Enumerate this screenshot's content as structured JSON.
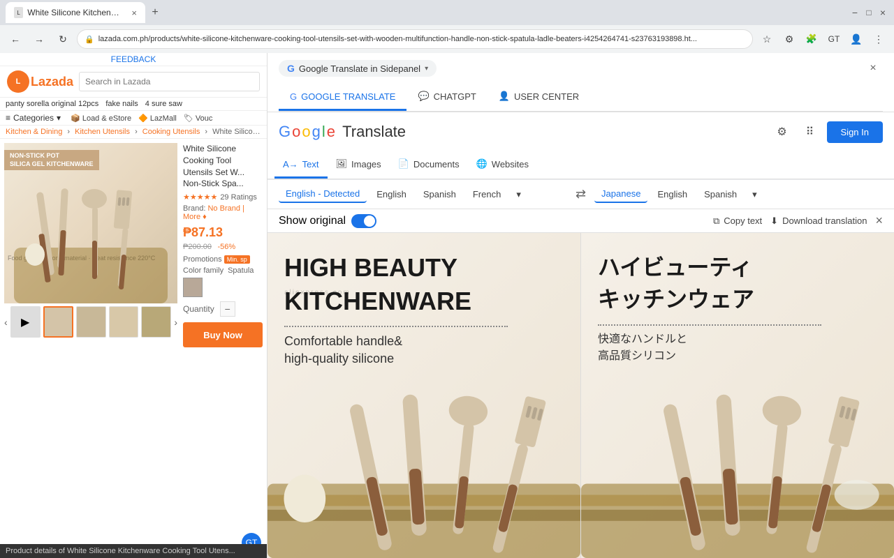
{
  "browser": {
    "tab_title": "White Silicone Kitchenware C...",
    "url": "lazada.com.ph/products/white-silicone-kitchenware-cooking-tool-utensils-set-with-wooden-multifunction-handle-non-stick-spatula-ladle-beaters-i4254264741-s23763193898.ht...",
    "new_tab_label": "+",
    "back_icon": "←",
    "forward_icon": "→",
    "reload_icon": "↻",
    "home_icon": "⌂",
    "extensions_icon": "⚙",
    "window_controls": {
      "minimize": "−",
      "maximize": "□",
      "close": "×"
    }
  },
  "lazada": {
    "feedback_label": "FEEDBACK",
    "logo_text": "Lazada",
    "search_placeholder": "Search in Lazada",
    "nav_items": [
      "Load & eStore",
      "LazMall",
      "Vouc"
    ],
    "nav_scrolling_items": [
      "panty sorella original 12pcs",
      "fake nails",
      "4 sure saw"
    ],
    "categories_label": "Categories",
    "breadcrumbs": [
      "Kitchen & Dining",
      "Kitchen Utensils",
      "Cooking Utensils",
      "White Silicone Kitc..."
    ],
    "product_title": "White Silicone Cooking Tool Utensils Set W... Non-Stick Spa...",
    "rating": "★★★★★",
    "rating_count": "29 Ratings",
    "brand_label": "Brand:",
    "brand_value": "No Brand",
    "brand_more": "More ♦",
    "price_current": "₱87.13",
    "price_original": "₱200.00",
    "price_discount": "-56%",
    "promotions_label": "Promotions",
    "promo_badge": "Min. sp",
    "color_family_label": "Color family",
    "color_name": "Spatula",
    "quantity_label": "Quantity",
    "qty_minus": "−",
    "buy_btn_label": "Buy Now",
    "non_stick_label": "NON-STICK POT\nSILICA GEL KITCHENWARE",
    "food_grade_label": "Food grade silicone material · Heat resistance 220°C",
    "bottom_status": "Product details of White Silicone Kitchenware Cooking Tool Utens..."
  },
  "panel": {
    "dropdown_label": "Google Translate in Sidepanel",
    "close_icon": "×",
    "tabs": [
      {
        "id": "google-translate",
        "label": "GOOGLE TRANSLATE",
        "active": true
      },
      {
        "id": "chatgpt",
        "label": "CHATGPT",
        "active": false
      },
      {
        "id": "user-center",
        "label": "USER CENTER",
        "active": false
      }
    ]
  },
  "google_translate": {
    "logo_text": "Google Translate",
    "signin_label": "Sign In",
    "service_tabs": [
      {
        "id": "text",
        "label": "Text",
        "icon": "A→",
        "active": true
      },
      {
        "id": "images",
        "label": "Images",
        "icon": "🖼",
        "active": false
      },
      {
        "id": "documents",
        "label": "Documents",
        "icon": "📄",
        "active": false
      },
      {
        "id": "websites",
        "label": "Websites",
        "icon": "🌐",
        "active": false
      }
    ],
    "source_langs": [
      {
        "label": "English - Detected",
        "active": true
      },
      {
        "label": "English",
        "active": false
      },
      {
        "label": "Spanish",
        "active": false
      },
      {
        "label": "French",
        "active": false
      }
    ],
    "target_langs": [
      {
        "label": "Japanese",
        "active": true
      },
      {
        "label": "English",
        "active": false
      },
      {
        "label": "Spanish",
        "active": false
      }
    ],
    "show_original_label": "Show original",
    "copy_text_label": "Copy text",
    "download_translation_label": "Download translation",
    "close_translation_icon": "×",
    "swap_icon": "⇄",
    "more_icon": "▾"
  },
  "translation_content": {
    "original": {
      "title_line1": "HIGH BEAUTY",
      "title_line2": "KITCHENWARE",
      "watermark": "aliexpress.com",
      "subtitle_line1": "Comfortable handle&",
      "subtitle_line2": "high-quality silicone"
    },
    "translated": {
      "title_line1": "ハイビューティ",
      "title_line2": "キッチンウェア",
      "subtitle_line1": "快適なハンドルと",
      "subtitle_line2": "高品質シリコン"
    }
  },
  "colors": {
    "lazada_orange": "#f57224",
    "google_blue": "#1a73e8",
    "active_tab_blue": "#1a73e8",
    "star_color": "#f57224",
    "bg_light": "#f1f3f4"
  }
}
